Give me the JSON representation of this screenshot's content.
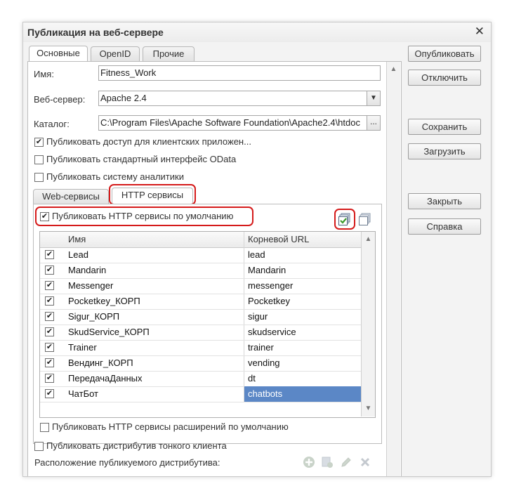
{
  "window": {
    "title": "Публикация на веб-сервере"
  },
  "tabs": [
    "Основные",
    "OpenID",
    "Прочие"
  ],
  "form": {
    "name_label": "Имя:",
    "name_value": "Fitness_Work",
    "webserver_label": "Веб-сервер:",
    "webserver_value": "Apache 2.4",
    "catalog_label": "Каталог:",
    "catalog_value": "C:\\Program Files\\Apache Software Foundation\\Apache2.4\\htdoc",
    "catalog_button": "...",
    "opt_client_apps": "Публиковать доступ для клиентских приложен...",
    "opt_odata": "Публиковать стандартный интерфейс OData",
    "opt_analytics": "Публиковать систему аналитики"
  },
  "inner_tabs": [
    "Web-сервисы",
    "HTTP сервисы"
  ],
  "http": {
    "publish_default_label": "Публиковать HTTP сервисы по умолчанию",
    "columns": [
      "Имя",
      "Корневой URL"
    ],
    "rows": [
      {
        "name": "Lead",
        "url": "lead",
        "checked": true
      },
      {
        "name": "Mandarin",
        "url": "Mandarin",
        "checked": true
      },
      {
        "name": "Messenger",
        "url": "messenger",
        "checked": true
      },
      {
        "name": "Pocketkey_КОРП",
        "url": "Pocketkey",
        "checked": true
      },
      {
        "name": "Sigur_КОРП",
        "url": "sigur",
        "checked": true
      },
      {
        "name": "SkudService_КОРП",
        "url": "skudservice",
        "checked": true
      },
      {
        "name": "Trainer",
        "url": "trainer",
        "checked": true
      },
      {
        "name": "Вендинг_КОРП",
        "url": "vending",
        "checked": true
      },
      {
        "name": "ПередачаДанных",
        "url": "dt",
        "checked": true
      },
      {
        "name": "ЧатБот",
        "url": "chatbots",
        "checked": true,
        "selected": true
      }
    ],
    "publish_ext_label": "Публиковать HTTP сервисы расширений по умолчанию"
  },
  "footer": {
    "thin_client_label": "Публиковать дистрибутив тонкого клиента",
    "location_label": "Расположение публикуемого дистрибутива:"
  },
  "buttons": {
    "publish": "Опубликовать",
    "disable": "Отключить",
    "save": "Сохранить",
    "load": "Загрузить",
    "close": "Закрыть",
    "help": "Справка"
  },
  "colors": {
    "highlight_red": "#d51b1b",
    "selected_cell": "#5b87c6",
    "check_green": "#3a9a2b"
  }
}
